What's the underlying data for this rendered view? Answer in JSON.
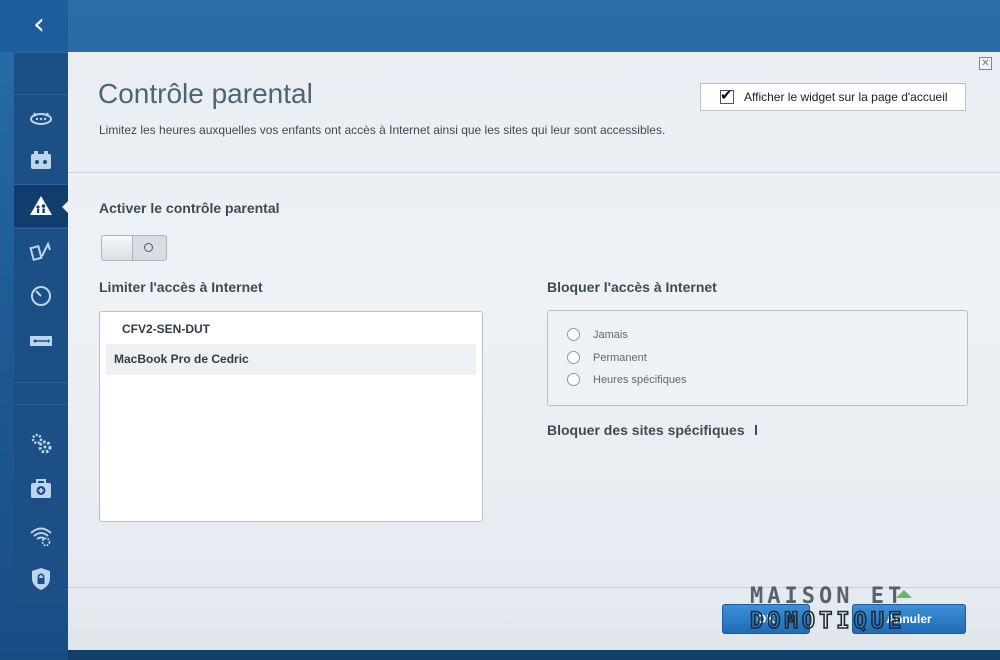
{
  "header": {
    "title": "Contrôle parental",
    "subtitle": "Limitez les heures auxquelles vos enfants ont accès à Internet ainsi que les sites qui leur sont accessibles.",
    "widget_label": "Afficher le widget sur la page d'accueil",
    "widget_checked": true
  },
  "enable": {
    "label": "Activer le contrôle parental",
    "state": "off"
  },
  "limit_access": {
    "label": "Limiter l'accès à Internet",
    "devices": [
      "CFV2-SEN-DUT",
      "MacBook Pro de Cedric"
    ],
    "selected_index": 1
  },
  "block_access": {
    "label": "Bloquer l'accès à Internet",
    "options": [
      "Jamais",
      "Permanent",
      "Heures spécifiques"
    ]
  },
  "block_sites": {
    "label": "Bloquer des sites spécifiques"
  },
  "footer": {
    "ok_label": "OK",
    "cancel_label": "Annuler"
  },
  "watermark": {
    "line1": "MAISON ET",
    "line2": "DOMOTIQUE"
  },
  "colors": {
    "accent": "#1f6cb5",
    "sidebar": "#1b4f85",
    "panel": "#eef2f6"
  },
  "sidebar_icons": [
    "router-icon",
    "devices-icon",
    "parental-control-icon",
    "media-priority-icon",
    "speed-test-icon",
    "usb-storage-icon",
    "settings-icon",
    "troubleshooting-icon",
    "wireless-icon",
    "security-icon"
  ]
}
